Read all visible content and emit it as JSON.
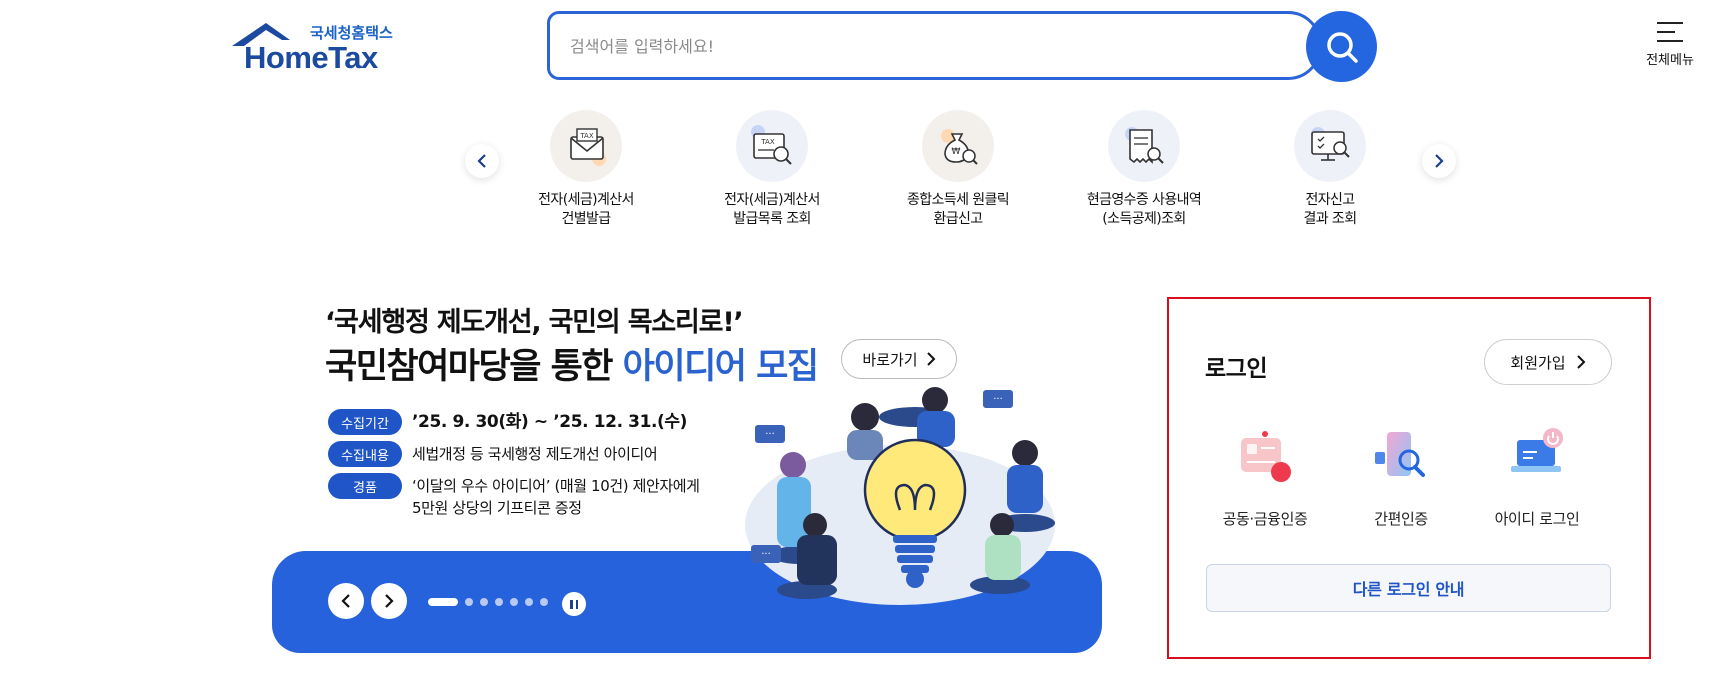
{
  "header": {
    "logo_sub": "국세청홈택스",
    "logo_main": "HomeTax",
    "search_placeholder": "검색어를 입력하세요!",
    "menu_label": "전체메뉴"
  },
  "quick_menu": [
    {
      "label": "전자(세금)계산서\n건별발급",
      "icon": "tax-envelope-icon"
    },
    {
      "label": "전자(세금)계산서\n발급목록 조회",
      "icon": "tax-document-search-icon"
    },
    {
      "label": "종합소득세 원클릭\n환급신고",
      "icon": "money-bag-search-icon"
    },
    {
      "label": "현금영수증 사용내역\n(소득공제)조회",
      "icon": "receipt-search-icon"
    },
    {
      "label": "전자신고\n결과 조회",
      "icon": "monitor-search-icon"
    }
  ],
  "banner": {
    "title_line1": "‘국세행정 제도개선, 국민의 목소리로!’",
    "title_line2_prefix": "국민참여마당을 통한 ",
    "title_line2_highlight": "아이디어 모집",
    "shortcut_label": "바로가기",
    "info": [
      {
        "tag": "수집기간",
        "value": "’25. 9. 30(화) ~ ’25. 12. 31.(수)"
      },
      {
        "tag": "수집내용",
        "value": "세법개정 등 국세행정 제도개선 아이디어"
      },
      {
        "tag": "경품",
        "value": "‘이달의 우수 아이디어’ (매월 10건) 제안자에게\n5만원 상당의 기프티콘 증정"
      }
    ],
    "slide_count": 7,
    "active_slide": 1
  },
  "login": {
    "title": "로그인",
    "signup_label": "회원가입",
    "options": [
      {
        "label": "공동·금융인증",
        "icon": "certificate-icon"
      },
      {
        "label": "간편인증",
        "icon": "simple-auth-icon"
      },
      {
        "label": "아이디 로그인",
        "icon": "laptop-login-icon"
      }
    ],
    "other_login_label": "다른 로그인 안내"
  },
  "colors": {
    "brand_blue": "#2762dd",
    "highlight_blue": "#2a62cf",
    "login_border_red": "#d90f1e"
  }
}
